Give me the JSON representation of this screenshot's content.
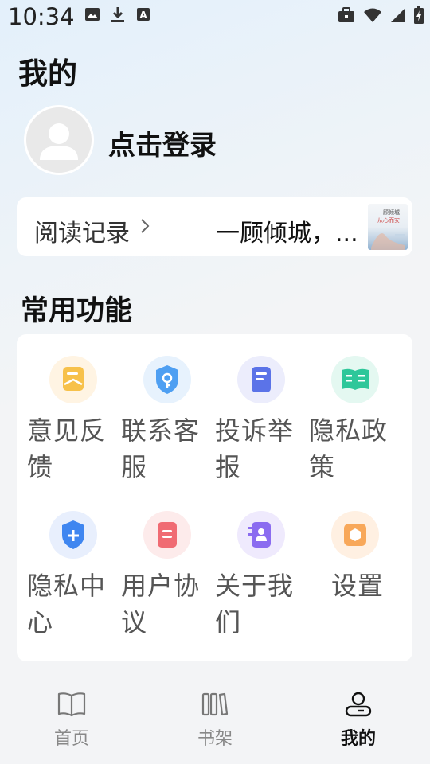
{
  "status_bar": {
    "time": "10:34",
    "left_icons": [
      "image-icon",
      "download-icon",
      "a-icon"
    ],
    "right_icons": [
      "briefcase-icon",
      "wifi-icon",
      "signal-icon",
      "battery-icon"
    ]
  },
  "page_title": "我的",
  "profile": {
    "login_text": "点击登录"
  },
  "reading_history": {
    "label": "阅读记录",
    "book_title": "一顾倾城，...",
    "cover_text_line1": "一顾倾城",
    "cover_text_line2": "从心而安"
  },
  "common_functions": {
    "title": "常用功能",
    "items": [
      {
        "label": "意见反馈",
        "icon": "feedback-icon",
        "color": "#f7c14a",
        "bg": "#fff4e3"
      },
      {
        "label": "联系客服",
        "icon": "customer-service-icon",
        "color": "#4e9ff2",
        "bg": "#e7f2fd"
      },
      {
        "label": "投诉举报",
        "icon": "complaint-icon",
        "color": "#5b73e8",
        "bg": "#ecedfc"
      },
      {
        "label": "隐私政策",
        "icon": "privacy-policy-icon",
        "color": "#2ec79a",
        "bg": "#e4f8f1"
      },
      {
        "label": "隐私中心",
        "icon": "privacy-center-icon",
        "color": "#3f86f0",
        "bg": "#e8effd"
      },
      {
        "label": "用户协议",
        "icon": "user-agreement-icon",
        "color": "#f06b73",
        "bg": "#fdebeb"
      },
      {
        "label": "关于我们",
        "icon": "about-us-icon",
        "color": "#8b6cf0",
        "bg": "#efeafd"
      },
      {
        "label": "设置",
        "icon": "settings-icon",
        "color": "#f8a85a",
        "bg": "#fff0e2"
      }
    ]
  },
  "tab_bar": {
    "tabs": [
      {
        "label": "首页",
        "icon": "book-open-icon",
        "active": false
      },
      {
        "label": "书架",
        "icon": "bookshelf-icon",
        "active": false
      },
      {
        "label": "我的",
        "icon": "profile-icon",
        "active": true
      }
    ]
  }
}
